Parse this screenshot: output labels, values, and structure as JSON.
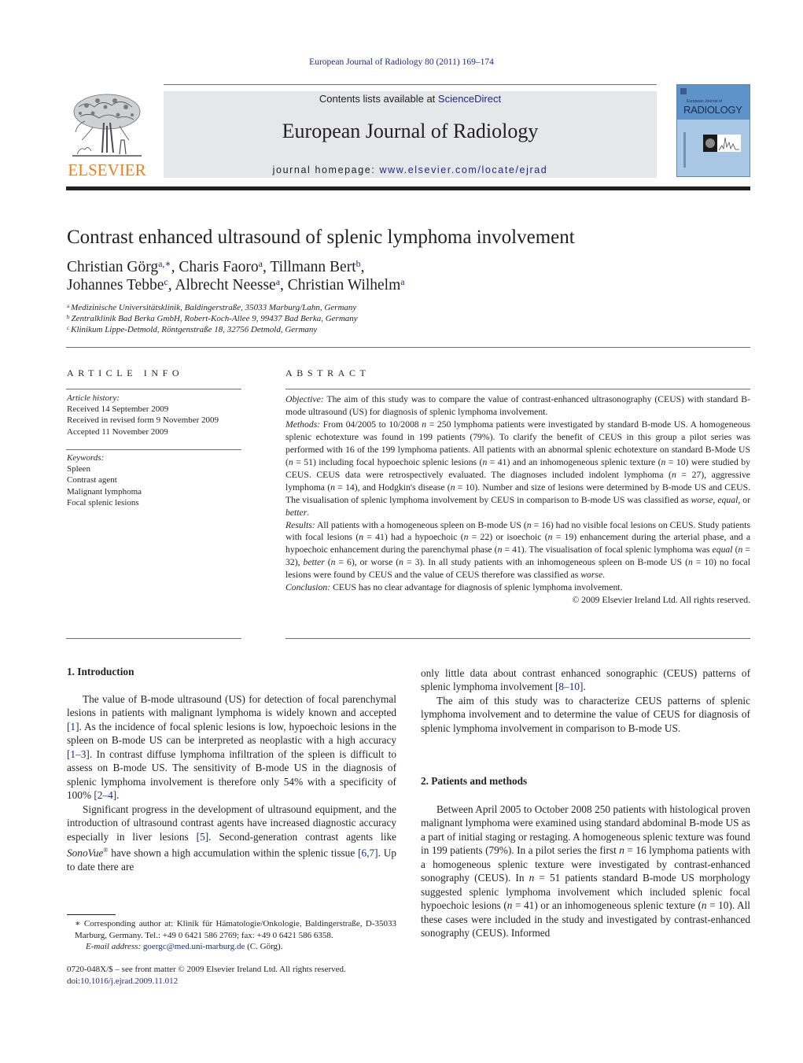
{
  "header": {
    "running_head": "European Journal of Radiology 80 (2011) 169–174",
    "publisher_logo_text": "ELSEVIER",
    "contents_prefix": "Contents lists available at ",
    "contents_link": "ScienceDirect",
    "journal_title": "European Journal of Radiology",
    "homepage_prefix": "journal homepage: ",
    "homepage_link": "www.elsevier.com/locate/ejrad",
    "cover": {
      "small_text": "European Journal of",
      "big_text": "RADIOLOGY"
    },
    "colors": {
      "link": "#1c2a86",
      "elsevier_orange": "#f07f1a",
      "masthead_bg": "#e6e7e8",
      "cover_blue": "#7aa6d1"
    }
  },
  "article": {
    "title": "Contrast enhanced ultrasound of splenic lymphoma involvement",
    "authors_line1": [
      {
        "name": "Christian Görg",
        "sup": "a,∗",
        "sep": ", "
      },
      {
        "name": "Charis Faoro",
        "sup": "a",
        "sep": ", "
      },
      {
        "name": "Tillmann Bert",
        "sup": "b",
        "sep": ","
      }
    ],
    "authors_line2": [
      {
        "name": "Johannes Tebbe",
        "sup": "c",
        "sep": ", "
      },
      {
        "name": "Albrecht Neesse",
        "sup": "a",
        "sep": ", "
      },
      {
        "name": "Christian Wilhelm",
        "sup": "a",
        "sep": ""
      }
    ],
    "affiliations": [
      {
        "mark": "a",
        "text": "Medizinische Universitätsklinik, Baldingerstraße, 35033 Marburg/Lahn, Germany"
      },
      {
        "mark": "b",
        "text": "Zentralklinik Bad Berka GmbH, Robert-Koch-Allee 9, 99437 Bad Berka, Germany"
      },
      {
        "mark": "c",
        "text": "Klinikum Lippe-Detmold, Röntgenstraße 18, 32756 Detmold, Germany"
      }
    ]
  },
  "article_info": {
    "heading": "ARTICLE INFO",
    "history_label": "Article history:",
    "history": [
      "Received 14 September 2009",
      "Received in revised form 9 November 2009",
      "Accepted 11 November 2009"
    ],
    "keywords_label": "Keywords:",
    "keywords": [
      "Spleen",
      "Contrast agent",
      "Malignant lymphoma",
      "Focal splenic lesions"
    ]
  },
  "abstract": {
    "heading": "ABSTRACT",
    "objective_label": "Objective:",
    "objective": " The aim of this study was to compare the value of contrast-enhanced ultrasonography (CEUS) with standard B-mode ultrasound (US) for diagnosis of splenic lymphoma involvement.",
    "methods_label": "Methods:",
    "methods_a": " From 04/2005 to 10/2008 ",
    "methods_b": " = 250 lymphoma patients were investigated by standard B-mode US. A homogeneous splenic echotexture was found in 199 patients (79%). To clarify the benefit of CEUS in this group a pilot series was performed with 16 of the 199 lymphoma patients. All patients with an abnormal splenic echotexture on standard B-Mode US (",
    "methods_c": " = 51) including focal hypoechoic splenic lesions (",
    "methods_d": " = 41) and an inhomogeneous splenic texture (",
    "methods_e": " = 10) were studied by CEUS. CEUS data were retrospectively evaluated. The diagnoses included indolent lymphoma (",
    "methods_f": " = 27), aggressive lymphoma (",
    "methods_g": " = 14), and Hodgkin's disease (",
    "methods_h": " = 10). Number and size of lesions were determined by B-mode US and CEUS. The visualisation of splenic lymphoma involvement by CEUS in comparison to B-mode US was classified as ",
    "methods_worse": "worse",
    "methods_comma": ", ",
    "methods_equal": "equal",
    "methods_or": ", or ",
    "methods_better": "better",
    "methods_end": ".",
    "results_label": "Results:",
    "results_a": " All patients with a homogeneous spleen on B-mode US (",
    "results_b": " = 16) had no visible focal lesions on CEUS. Study patients with focal lesions (",
    "results_c": " = 41) had a hypoechoic (",
    "results_d": " = 22) or isoechoic (",
    "results_e": " = 19) enhancement during the arterial phase, and a hypoechoic enhancement during the parenchymal phase (",
    "results_f": " = 41). The visualisation of focal splenic lymphoma was ",
    "results_equal": "equal",
    "results_g": " (",
    "results_h": " = 32), ",
    "results_better": "better",
    "results_i": " (",
    "results_j": " = 6), or worse (",
    "results_k": " = 3). In all study patients with an inhomogeneous spleen on B-mode US (",
    "results_l": " = 10) no focal lesions were found by CEUS and the value of CEUS therefore was classified as ",
    "results_worse": "worse",
    "results_end": ".",
    "n": "n",
    "conclusion_label": "Conclusion:",
    "conclusion": " CEUS has no clear advantage for diagnosis of splenic lymphoma involvement.",
    "copyright": "© 2009 Elsevier Ireland Ltd. All rights reserved."
  },
  "body": {
    "intro_heading": "1.  Introduction",
    "intro_p1_a": "The value of B-mode ultrasound (US) for detection of focal parenchymal lesions in patients with malignant lymphoma is widely known and accepted ",
    "ref_1": "[1]",
    "intro_p1_b": ". As the incidence of focal splenic lesions is low, hypoechoic lesions in the spleen on B-mode US can be interpreted as neoplastic with a high accuracy ",
    "ref_1_3": "[1–3]",
    "intro_p1_c": ". In contrast diffuse lymphoma infiltration of the spleen is difficult to assess on B-mode US. The sensitivity of B-mode US in the diagnosis of splenic lymphoma involvement is therefore only 54% with a specificity of 100% ",
    "ref_2_4": "[2–4]",
    "intro_p1_d": ".",
    "intro_p2_a": "Significant progress in the development of ultrasound equipment, and the introduction of ultrasound contrast agents have increased diagnostic accuracy especially in liver lesions ",
    "ref_5": "[5]",
    "intro_p2_b": ". Second-generation contrast agents like ",
    "sonovue": "SonoVue",
    "reg": "®",
    "intro_p2_c": " have shown a high accumulation within the splenic tissue ",
    "ref_6_7": "[6,7]",
    "intro_p2_d": ". Up to date there are",
    "right_p1_a": "only little data about contrast enhanced sonographic (CEUS) patterns of splenic lymphoma involvement ",
    "ref_8_10": "[8–10]",
    "right_p1_b": ".",
    "right_p2": "The aim of this study was to characterize CEUS patterns of splenic lymphoma involvement and to determine the value of CEUS for diagnosis of splenic lymphoma involvement in comparison to B-mode US.",
    "methods_heading": "2.  Patients and methods",
    "methods_p1_a": "Between April 2005 to October 2008 250 patients with histological proven malignant lymphoma were examined using standard abdominal B-mode US as a part of initial staging or restaging. A homogeneous splenic texture was found in 199 patients (79%). In a pilot series the first ",
    "methods_p1_b": " = 16 lymphoma patients with a homogeneous splenic texture were investigated by contrast-enhanced sonography (CEUS). In ",
    "methods_p1_c": " = 51 patients standard B-mode US morphology suggested splenic lymphoma involvement which included splenic focal hypoechoic lesions (",
    "methods_p1_d": " = 41) or an inhomogeneous splenic texture (",
    "methods_p1_e": " = 10). All these cases were included in the study and investigated by contrast-enhanced sonography (CEUS). Informed",
    "n": "n"
  },
  "footnotes": {
    "corresponding": "∗  Corresponding author at: Klinik für Hämatologie/Onkologie, Baldingerstraße, D-35033 Marburg, Germany. Tel.: +49 0 6421 586 2769; fax: +49 0 6421 586 6358.",
    "email_label": "E-mail address:",
    "email": "goergc@med.uni-marburg.de",
    "email_suffix": " (C. Görg).",
    "front_matter": "0720-048X/$ – see front matter © 2009 Elsevier Ireland Ltd. All rights reserved.",
    "doi_prefix": "doi:",
    "doi": "10.1016/j.ejrad.2009.11.012"
  }
}
